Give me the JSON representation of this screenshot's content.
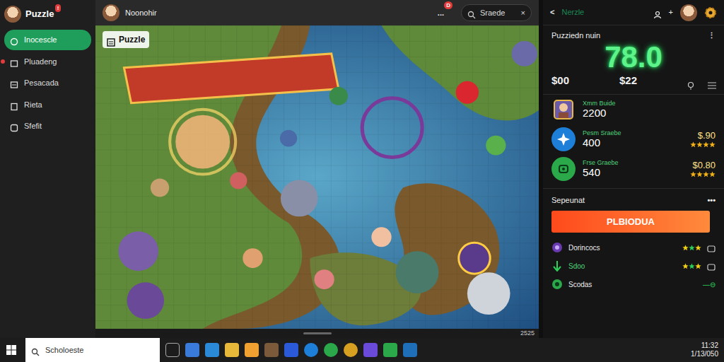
{
  "app": {
    "title": "Puzzle",
    "badge": "!"
  },
  "sidebar": {
    "items": [
      {
        "label": "Inocescle",
        "selected": true,
        "alert": false
      },
      {
        "label": "Pluadeng",
        "selected": false,
        "alert": true
      },
      {
        "label": "Pesacada",
        "selected": false,
        "alert": false
      },
      {
        "label": "Rieta",
        "selected": false,
        "alert": false
      },
      {
        "label": "Sfefit",
        "selected": false,
        "alert": false
      }
    ]
  },
  "topbar": {
    "user": "Noonohir",
    "menu": "...",
    "badge": "D",
    "search": {
      "value": "Sraede",
      "clear": "×"
    }
  },
  "puzzle": {
    "label": "Puzzle",
    "counter": "2525"
  },
  "panel": {
    "back": "<",
    "title": "Nerzle",
    "add": "+",
    "card": {
      "title": "Puzziedn nuin",
      "more": "⋮",
      "score": "78.0",
      "left": "$00",
      "right": "$22"
    },
    "players": [
      {
        "name": "Xmm Buide",
        "value": "2200",
        "price": "",
        "stars": 0
      },
      {
        "name": "Pesm Sraebe",
        "value": "400",
        "price": "$.90",
        "stars": 4
      },
      {
        "name": "Frse Graebe",
        "value": "540",
        "price": "$0.80",
        "stars": 4
      }
    ],
    "section": {
      "title": "Sepeunat",
      "more": "•••"
    },
    "button": "PLBIODUA",
    "rows": [
      {
        "label": "Dorincocs",
        "stars": 3,
        "trail": ""
      },
      {
        "label": "Sdoo",
        "stars": 3,
        "trail": ""
      },
      {
        "label": "Scodas",
        "stars": 0,
        "trail": "—⊖"
      }
    ]
  },
  "taskbar": {
    "search": "Scholoeste",
    "time": "11:32",
    "date": "1/13/050"
  }
}
